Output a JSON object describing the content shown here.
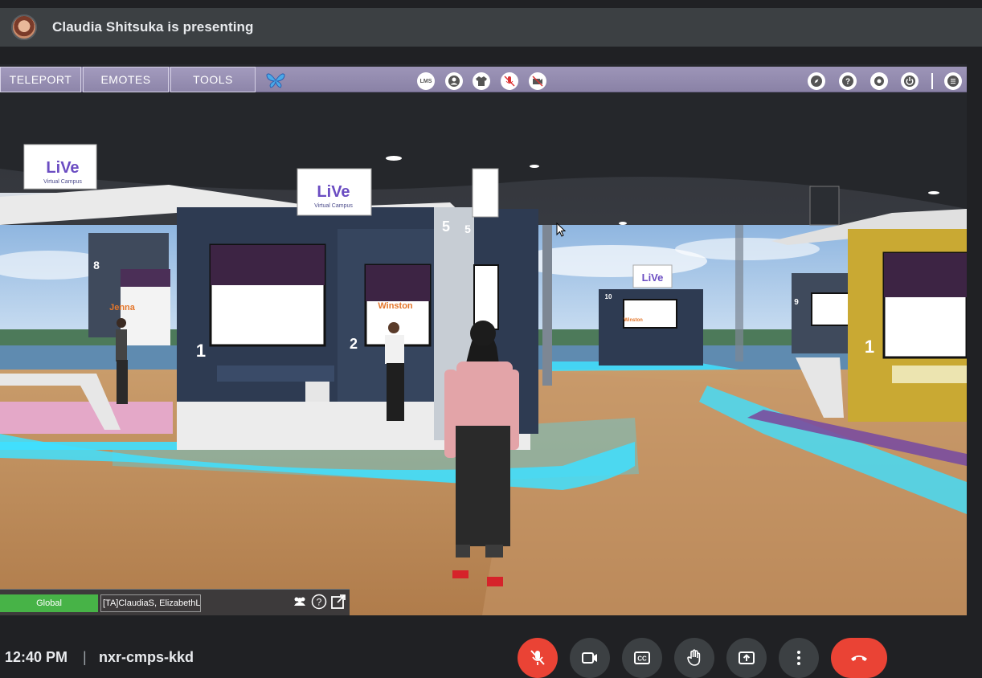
{
  "header": {
    "presenter_text": "Claudia Shitsuka is presenting"
  },
  "game": {
    "toolbar": {
      "teleport_label": "TELEPORT",
      "emotes_label": "EMOTES",
      "tools_label": "TOOLS",
      "center_icons": [
        "lms-icon",
        "profile-icon",
        "outfit-icon",
        "microphone-muted-icon",
        "camera-off-icon"
      ],
      "right_icons": [
        "compass-icon",
        "help-icon",
        "settings-icon",
        "power-icon",
        "menu-icon"
      ],
      "lms_label": "LMS"
    },
    "scene": {
      "signs": [
        "LiVe",
        "Virtual Campus"
      ],
      "booth_numbers": [
        "8",
        "1",
        "2",
        "5",
        "5",
        "10",
        "9",
        "1"
      ],
      "name_tags": [
        "Jenna",
        "Winston",
        "Winston"
      ]
    },
    "chat": {
      "channel_label": "Global",
      "users_label": "[TA]ClaudiaS, ElizabethL"
    }
  },
  "bottom_bar": {
    "time": "12:40 PM",
    "separator": "|",
    "meeting_code": "nxr-cmps-kkd"
  },
  "colors": {
    "meet_background": "#202124",
    "meet_header": "#3c4043",
    "toolbar_purple": "#9d95b8",
    "chat_green": "#47b347",
    "mic_off_red": "#ea4335",
    "floor_glow": "#3fe0ff",
    "floor_wood": "#b98a5c"
  }
}
